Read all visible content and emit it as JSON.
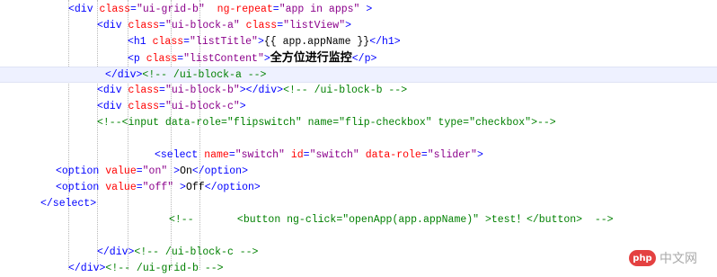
{
  "lines": [
    {
      "id": "l1",
      "segments": [
        {
          "c": "tag",
          "t": "<div "
        },
        {
          "c": "attr",
          "t": "class"
        },
        {
          "c": "tag",
          "t": "="
        },
        {
          "c": "val",
          "t": "\"ui-grid-b\""
        },
        {
          "c": "tag",
          "t": "  "
        },
        {
          "c": "attr",
          "t": "ng-repeat"
        },
        {
          "c": "tag",
          "t": "="
        },
        {
          "c": "val",
          "t": "\"app in apps\""
        },
        {
          "c": "tag",
          "t": " >"
        }
      ]
    },
    {
      "id": "l2",
      "segments": [
        {
          "c": "tag",
          "t": "<div "
        },
        {
          "c": "attr",
          "t": "class"
        },
        {
          "c": "tag",
          "t": "="
        },
        {
          "c": "val",
          "t": "\"ui-block-a\""
        },
        {
          "c": "tag",
          "t": " "
        },
        {
          "c": "attr",
          "t": "class"
        },
        {
          "c": "tag",
          "t": "="
        },
        {
          "c": "val",
          "t": "\"listView\""
        },
        {
          "c": "tag",
          "t": ">"
        }
      ]
    },
    {
      "id": "l3",
      "segments": [
        {
          "c": "tag",
          "t": "<h1 "
        },
        {
          "c": "attr",
          "t": "class"
        },
        {
          "c": "tag",
          "t": "="
        },
        {
          "c": "val",
          "t": "\"listTitle\""
        },
        {
          "c": "tag",
          "t": ">"
        },
        {
          "c": "txt",
          "t": "{{ app.appName }}"
        },
        {
          "c": "tag",
          "t": "</h1>"
        }
      ]
    },
    {
      "id": "l4",
      "segments": [
        {
          "c": "tag",
          "t": "<p "
        },
        {
          "c": "attr",
          "t": "class"
        },
        {
          "c": "tag",
          "t": "="
        },
        {
          "c": "val",
          "t": "\"listContent\""
        },
        {
          "c": "tag",
          "t": ">"
        },
        {
          "c": "cn",
          "t": "全方位进行监控"
        },
        {
          "c": "tag",
          "t": "</p>"
        }
      ]
    },
    {
      "id": "l5",
      "segments": [
        {
          "c": "tag",
          "t": "</div>"
        },
        {
          "c": "cmt",
          "t": "<!-- /ui-block-a -->"
        }
      ]
    },
    {
      "id": "l6",
      "segments": [
        {
          "c": "tag",
          "t": "<div "
        },
        {
          "c": "attr",
          "t": "class"
        },
        {
          "c": "tag",
          "t": "="
        },
        {
          "c": "val",
          "t": "\"ui-block-b\""
        },
        {
          "c": "tag",
          "t": "></div>"
        },
        {
          "c": "cmt",
          "t": "<!-- /ui-block-b -->"
        }
      ]
    },
    {
      "id": "l7",
      "segments": [
        {
          "c": "tag",
          "t": "<div "
        },
        {
          "c": "attr",
          "t": "class"
        },
        {
          "c": "tag",
          "t": "="
        },
        {
          "c": "val",
          "t": "\"ui-block-c\""
        },
        {
          "c": "tag",
          "t": ">"
        }
      ]
    },
    {
      "id": "l8",
      "segments": [
        {
          "c": "cmt",
          "t": "<!--<input data-role=\"flipswitch\" name=\"flip-checkbox\" type=\"checkbox\">-->"
        }
      ]
    },
    {
      "id": "l9",
      "segments": []
    },
    {
      "id": "l10",
      "segments": [
        {
          "c": "tag",
          "t": "<select "
        },
        {
          "c": "attr",
          "t": "name"
        },
        {
          "c": "tag",
          "t": "="
        },
        {
          "c": "val",
          "t": "\"switch\""
        },
        {
          "c": "tag",
          "t": " "
        },
        {
          "c": "attr",
          "t": "id"
        },
        {
          "c": "tag",
          "t": "="
        },
        {
          "c": "val",
          "t": "\"switch\""
        },
        {
          "c": "tag",
          "t": " "
        },
        {
          "c": "attr",
          "t": "data-role"
        },
        {
          "c": "tag",
          "t": "="
        },
        {
          "c": "val",
          "t": "\"slider\""
        },
        {
          "c": "tag",
          "t": ">"
        }
      ]
    },
    {
      "id": "l11",
      "segments": [
        {
          "c": "tag",
          "t": "<option "
        },
        {
          "c": "attr",
          "t": "value"
        },
        {
          "c": "tag",
          "t": "="
        },
        {
          "c": "val",
          "t": "\"on\""
        },
        {
          "c": "tag",
          "t": " >"
        },
        {
          "c": "txt",
          "t": "On"
        },
        {
          "c": "tag",
          "t": "</option>"
        }
      ]
    },
    {
      "id": "l12",
      "segments": [
        {
          "c": "tag",
          "t": "<option "
        },
        {
          "c": "attr",
          "t": "value"
        },
        {
          "c": "tag",
          "t": "="
        },
        {
          "c": "val",
          "t": "\"off\""
        },
        {
          "c": "tag",
          "t": " >"
        },
        {
          "c": "txt",
          "t": "Off"
        },
        {
          "c": "tag",
          "t": "</option>"
        }
      ]
    },
    {
      "id": "l13",
      "segments": [
        {
          "c": "tag",
          "t": "</select>"
        }
      ]
    },
    {
      "id": "l14",
      "segments": [
        {
          "c": "cmt",
          "t": "<!--       <button ng-click=\"openApp(app.appName)\" >test！</button>  -->"
        }
      ]
    },
    {
      "id": "l15",
      "segments": []
    },
    {
      "id": "l16",
      "segments": [
        {
          "c": "tag",
          "t": "</div>"
        },
        {
          "c": "cmt",
          "t": "<!-- /ui-block-c -->"
        }
      ]
    },
    {
      "id": "l17",
      "segments": [
        {
          "c": "tag",
          "t": "</div>"
        },
        {
          "c": "cmt",
          "t": "<!-- /ui-grid-b -->"
        }
      ]
    }
  ],
  "watermark": {
    "logo": "php",
    "text": "中文网"
  }
}
